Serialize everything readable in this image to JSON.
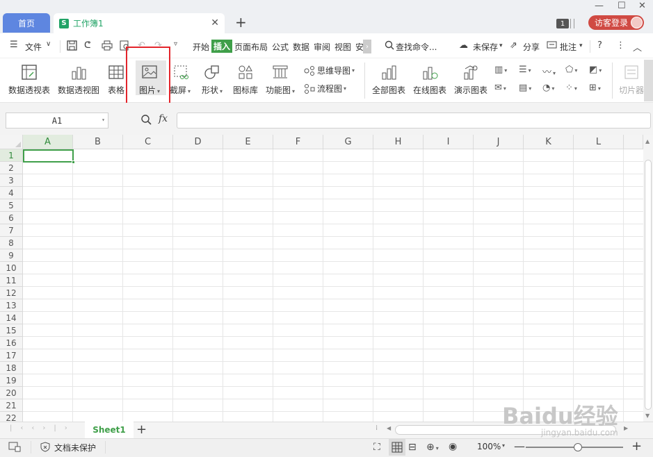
{
  "tabs": {
    "home": "首页",
    "doc": "工作簿1",
    "doc_icon": "S"
  },
  "title_right": {
    "badge": "1",
    "login": "访客登录"
  },
  "menu": {
    "file": "文件",
    "items": [
      "开始",
      "插入",
      "页面布局",
      "公式",
      "数据",
      "审阅",
      "视图",
      "安"
    ],
    "active": "插入",
    "search": "查找命令...",
    "unsaved": "未保存",
    "share": "分享",
    "comment": "批注"
  },
  "ribbon": {
    "pivot_table": "数据透视表",
    "pivot_chart": "数据透视图",
    "table": "表格",
    "picture": "图片",
    "screenshot": "截屏",
    "shape": "形状",
    "icon_lib": "图标库",
    "func_chart": "功能图",
    "mindmap": "思维导图",
    "flowchart": "流程图",
    "all_charts": "全部图表",
    "online_charts": "在线图表",
    "demo_charts": "演示图表",
    "slice": "切片器"
  },
  "formula_bar": {
    "cell_ref": "A1",
    "fx": "fx"
  },
  "grid": {
    "columns": [
      "A",
      "B",
      "C",
      "D",
      "E",
      "F",
      "G",
      "H",
      "I",
      "J",
      "K",
      "L"
    ],
    "rows": [
      "1",
      "2",
      "3",
      "4",
      "5",
      "6",
      "7",
      "8",
      "9",
      "10",
      "11",
      "12",
      "13",
      "14",
      "15",
      "16",
      "17",
      "18",
      "19",
      "20",
      "21",
      "22"
    ],
    "selected_cell": "A1"
  },
  "sheet": {
    "name": "Sheet1"
  },
  "status": {
    "protect": "文档未保护",
    "zoom": "100%"
  },
  "watermark": {
    "main": "Baidu经验",
    "sub": "jingyan.baidu.com"
  },
  "colors": {
    "accent": "#3f9f49",
    "home_tab": "#5e86e0",
    "login": "#d04a43",
    "highlight_box": "#e3242b"
  }
}
